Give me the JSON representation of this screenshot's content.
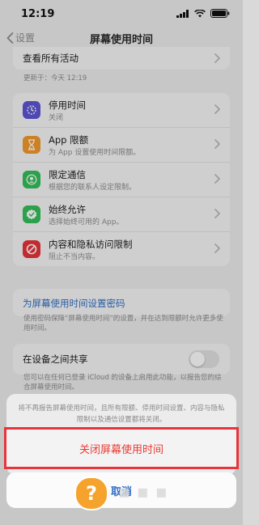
{
  "status_bar": {
    "time": "12:19"
  },
  "nav": {
    "back_label": "设置",
    "title": "屏幕使用时间"
  },
  "top_card": {
    "view_all": "查看所有活动"
  },
  "updated": "更新于：今天 12:19",
  "features": [
    {
      "title": "停用时间",
      "subtitle": "关闭",
      "icon": "downtime-icon",
      "color": "#5f55d6"
    },
    {
      "title": "App 限额",
      "subtitle": "为 App 设置使用时间限额。",
      "icon": "hourglass-icon",
      "color": "#f39a2b"
    },
    {
      "title": "限定通信",
      "subtitle": "根据您的联系人设定限制。",
      "icon": "contact-icon",
      "color": "#34c05a"
    },
    {
      "title": "始终允许",
      "subtitle": "选择始终可用的 App。",
      "icon": "checkmark-icon",
      "color": "#34c05a"
    },
    {
      "title": "内容和隐私访问限制",
      "subtitle": "阻止不当内容。",
      "icon": "prohibited-icon",
      "color": "#e8343a"
    }
  ],
  "passcode": {
    "link": "为屏幕使用时间设置密码",
    "note": "使用密码保障“屏幕使用时间”的设置，并在达到限额时允许更多使用时间。"
  },
  "share": {
    "label": "在设备之间共享",
    "note": "您可以在任何已登录 iCloud 的设备上启用此功能，以报告您的综合屏幕使用时间。"
  },
  "action_sheet": {
    "message": "将不再报告屏幕使用时间，且所有限额、停用时间设置、内容与隐私限制以及通信设置都将关闭。",
    "destructive": "关闭屏幕使用时间",
    "cancel": "取消"
  },
  "colors": {
    "accent": "#2f6ec7",
    "destructive": "#ea3a33",
    "highlight_box": "#e8343a"
  }
}
